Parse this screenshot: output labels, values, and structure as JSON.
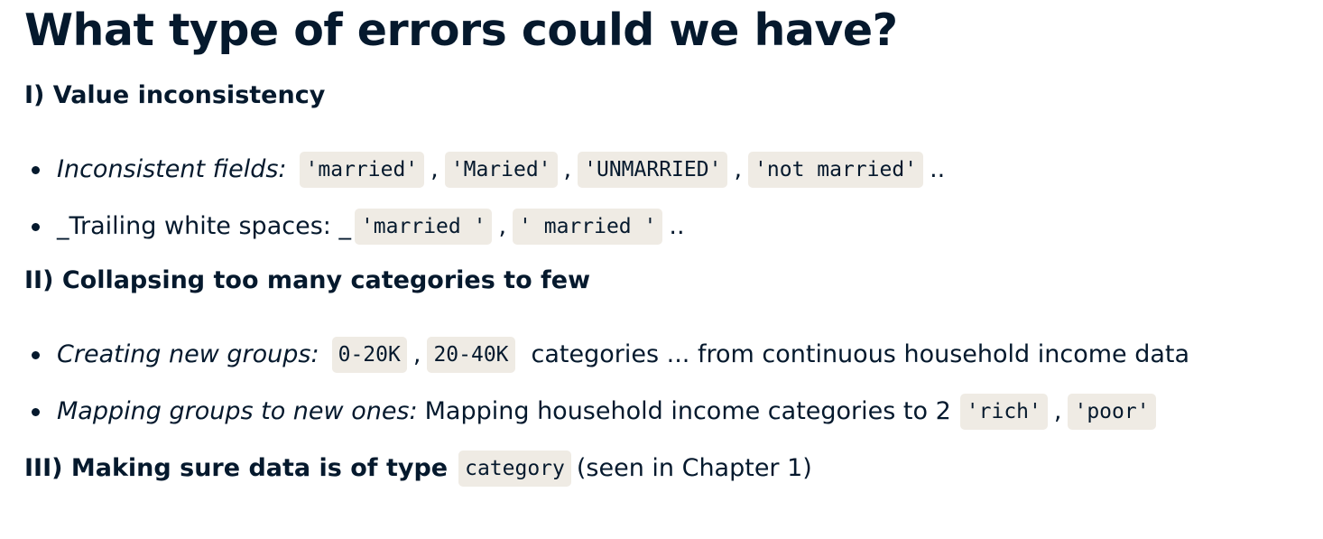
{
  "title": "What type of errors could we have?",
  "section_1": {
    "heading": "I) Value inconsistency"
  },
  "bullet_1": {
    "lead": "Inconsistent fields:",
    "codes": [
      "'married'",
      "'Maried'",
      "'UNMARRIED'",
      "'not married'"
    ],
    "separator": ",",
    "trail": ".."
  },
  "bullet_2": {
    "lead": "_Trailing white spaces: _",
    "codes": [
      "'married '",
      "' married '"
    ],
    "separator": ",",
    "trail": ".."
  },
  "section_2": {
    "heading": "II) Collapsing too many categories to few"
  },
  "bullet_3": {
    "lead": "Creating new groups:",
    "codes": [
      "0-20K",
      "20-40K"
    ],
    "separator": ",",
    "trail": "categories ... from continuous household income data"
  },
  "bullet_4": {
    "lead": "Mapping groups to new ones:",
    "text": "Mapping household income categories to 2",
    "codes": [
      "'rich'",
      "'poor'"
    ],
    "separator": ","
  },
  "section_3": {
    "heading": "III) Making sure data is of type",
    "code": "category",
    "trail": "(seen in Chapter 1)"
  }
}
